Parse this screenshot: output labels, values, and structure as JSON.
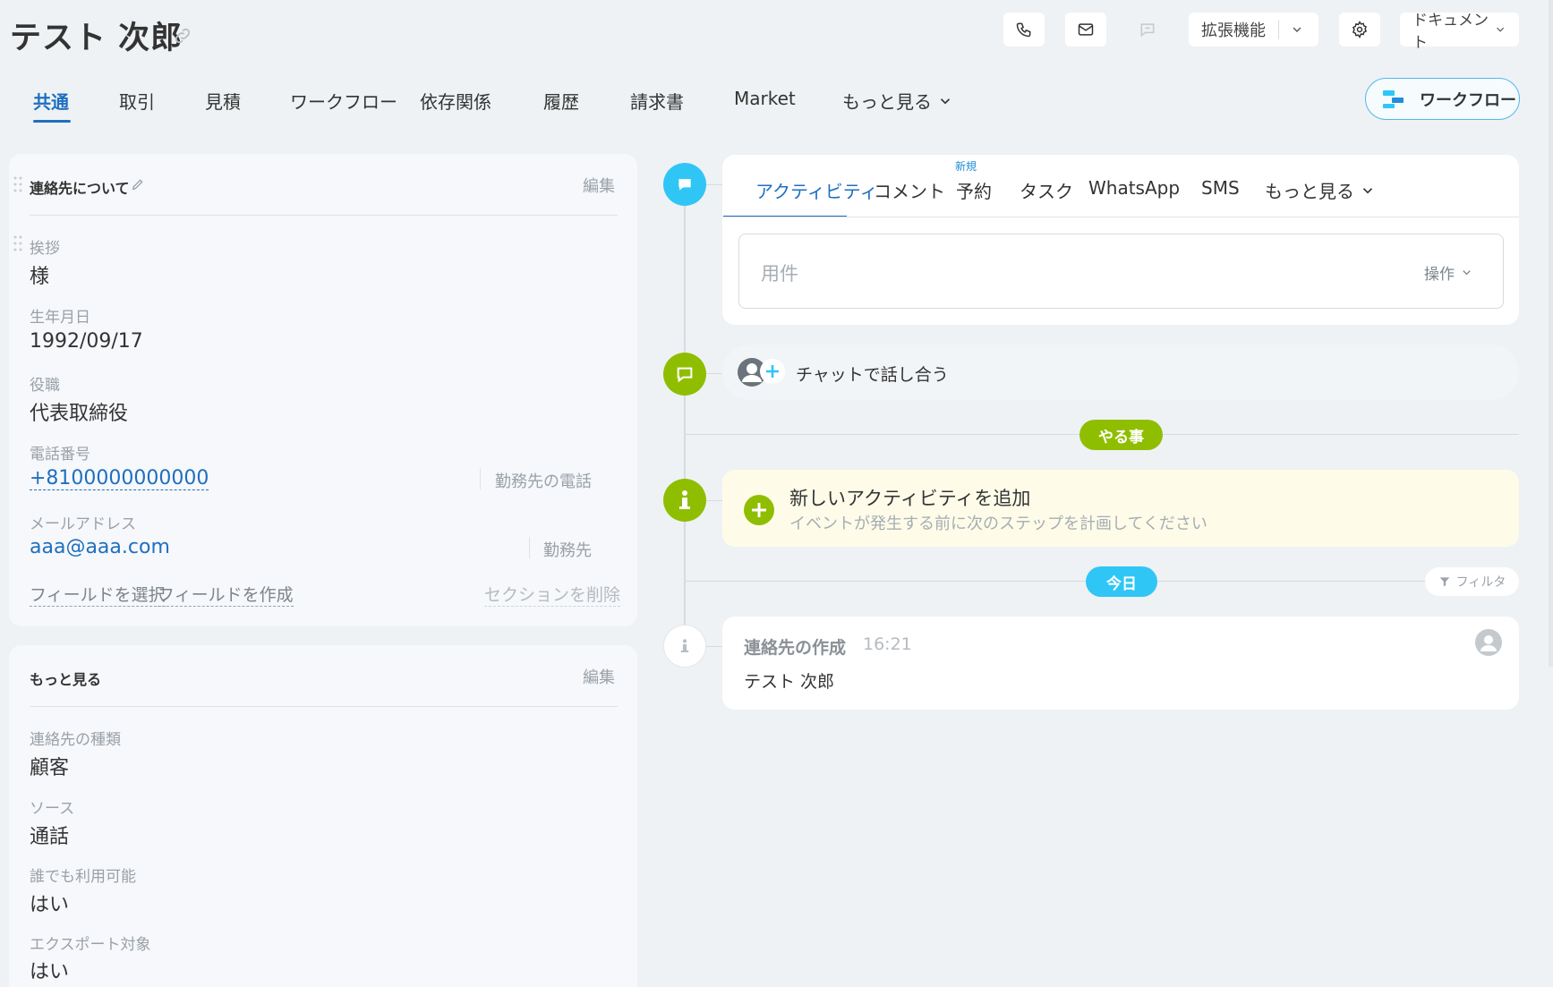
{
  "header": {
    "title": "テスト 次郎",
    "buttons": {
      "extensions_label": "拡張機能",
      "documents_label": "ドキュメント"
    }
  },
  "tabs": [
    "共通",
    "取引",
    "見積",
    "ワークフロー",
    "依存関係",
    "履歴",
    "請求書",
    "Market",
    "もっと見る"
  ],
  "workflow_button_label": "ワークフロー",
  "contact_card": {
    "title": "連絡先について",
    "edit_label": "編集",
    "fields": [
      {
        "label": "挨拶",
        "value": "様"
      },
      {
        "label": "生年月日",
        "value": "1992/09/17"
      },
      {
        "label": "役職",
        "value": "代表取締役"
      },
      {
        "label": "電話番号",
        "value": "+8100000000000",
        "type": "勤務先の電話"
      },
      {
        "label": "メールアドレス",
        "value": "aaa@aaa.com",
        "type": "勤務先"
      }
    ],
    "footer": {
      "select_field": "フィールドを選択",
      "create_field": "フィールドを作成",
      "delete_section": "セクションを削除"
    }
  },
  "more_card": {
    "title": "もっと見る",
    "edit_label": "編集",
    "fields": [
      {
        "label": "連絡先の種類",
        "value": "顧客"
      },
      {
        "label": "ソース",
        "value": "通話"
      },
      {
        "label": "誰でも利用可能",
        "value": "はい"
      },
      {
        "label": "エクスポート対象",
        "value": "はい"
      }
    ]
  },
  "activity": {
    "tabs": [
      "アクティビティ",
      "コメント",
      "予約",
      "タスク",
      "WhatsApp",
      "SMS",
      "もっと見る"
    ],
    "new_badge": "新規",
    "subject_placeholder": "用件",
    "operation_label": "操作",
    "chat_label": "チャットで話し合う",
    "todo_pill": "やる事",
    "todo_title": "新しいアクティビティを追加",
    "todo_subtitle": "イベントが発生する前に次のステップを計画してください",
    "today_pill": "今日",
    "filter_label": "フィルタ",
    "log": {
      "title": "連絡先の作成",
      "time": "16:21",
      "body": "テスト 次郎"
    }
  },
  "colors": {
    "accent_blue": "#1f6fbf",
    "timeline_blue": "#2fc6f6",
    "timeline_green": "#8fbe00",
    "todo_bg": "#fefce9"
  }
}
